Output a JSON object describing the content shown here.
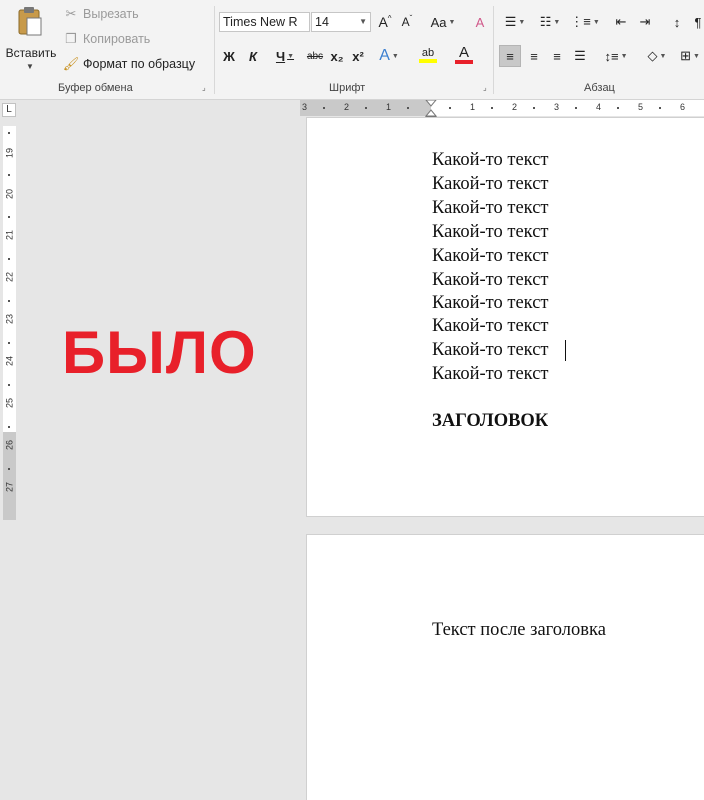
{
  "ribbon": {
    "clipboard": {
      "paste_label": "Вставить",
      "cut_label": "Вырезать",
      "copy_label": "Копировать",
      "format_painter_label": "Формат по образцу",
      "group_label": "Буфер обмена"
    },
    "font": {
      "font_name": "Times New R",
      "font_size": "14",
      "grow_label": "A",
      "shrink_label": "A",
      "case_label": "Aa",
      "bold_label": "Ж",
      "italic_label": "К",
      "underline_label": "Ч",
      "strike_label": "abc",
      "subscript_label": "x₂",
      "superscript_label": "x²",
      "effects_label": "A",
      "highlight_label": "ab",
      "color_label": "A",
      "highlight_color": "#ffff00",
      "font_color": "#e8202a",
      "group_label": "Шрифт"
    },
    "paragraph": {
      "group_label": "Абзац"
    }
  },
  "ruler": {
    "corner_label": "L",
    "h_numbers": [
      "3",
      "2",
      "1",
      "1",
      "2",
      "3",
      "4",
      "5",
      "6"
    ],
    "v_numbers": [
      "19",
      "20",
      "21",
      "22",
      "23",
      "24",
      "25",
      "26",
      "27"
    ]
  },
  "annotation": {
    "text": "БЫЛО",
    "color": "#e8202a"
  },
  "document": {
    "page1_lines": [
      "Какой-то текст",
      "Какой-то текст",
      "Какой-то текст",
      "Какой-то текст",
      "Какой-то текст",
      "Какой-то текст",
      "Какой-то текст",
      "Какой-то текст",
      "Какой-то текст",
      "Какой-то текст"
    ],
    "heading": "ЗАГОЛОВОК",
    "page2_text": "Текст после заголовка"
  }
}
